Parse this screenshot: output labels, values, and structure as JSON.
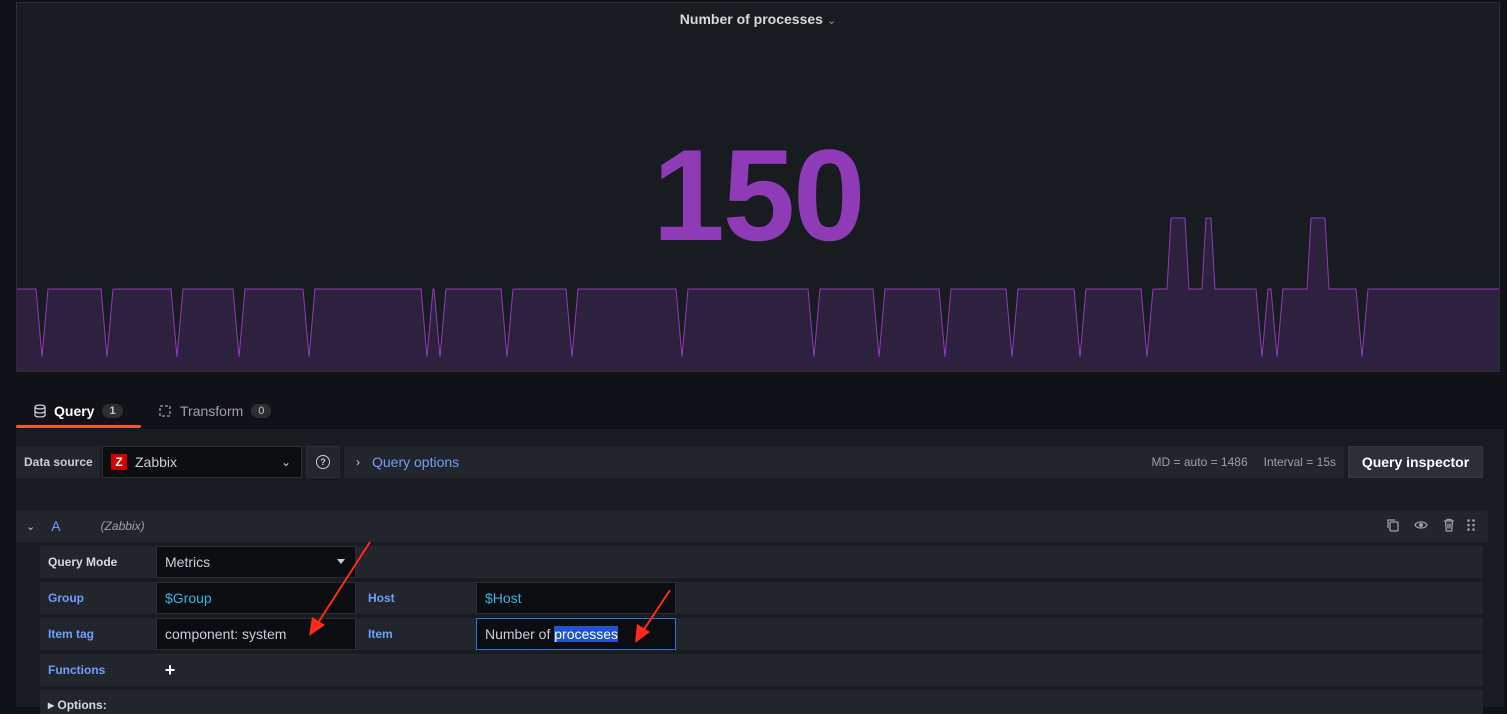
{
  "panel": {
    "title": "Number of processes",
    "stat_value": "150",
    "stat_color": "#8f3bb8",
    "chevron_icon": "chevron-down-icon"
  },
  "tabs": [
    {
      "label": "Query",
      "count": "1",
      "icon": "database-icon",
      "active": true
    },
    {
      "label": "Transform",
      "count": "0",
      "icon": "transform-icon",
      "active": false
    }
  ],
  "datasource": {
    "label": "Data source",
    "name": "Zabbix",
    "logo_letter": "Z",
    "help_icon": "question-circle-icon"
  },
  "query_options": {
    "label": "Query options",
    "md": "MD = auto = 1486",
    "interval": "Interval = 15s"
  },
  "query_inspector": {
    "label": "Query inspector"
  },
  "query": {
    "letter": "A",
    "datasource": "(Zabbix)",
    "actions": [
      "copy-icon",
      "eye-icon",
      "trash-icon",
      "drag-handle-icon"
    ]
  },
  "form": {
    "query_mode": {
      "label": "Query Mode",
      "value": "Metrics"
    },
    "group": {
      "label": "Group",
      "value": "$Group"
    },
    "host": {
      "label": "Host",
      "value": "$Host"
    },
    "item_tag": {
      "label": "Item tag",
      "value": "component: system"
    },
    "item": {
      "label": "Item",
      "value_prefix": "Number of ",
      "value_selected": "processes"
    },
    "functions": {
      "label": "Functions",
      "add": "+"
    },
    "options": {
      "label": "Options:"
    }
  },
  "colors": {
    "accent_tab": "#f05a28",
    "link_blue": "#6e9fff",
    "variable_cyan": "#33b5e5",
    "sparkline": "#8f3bb8"
  }
}
